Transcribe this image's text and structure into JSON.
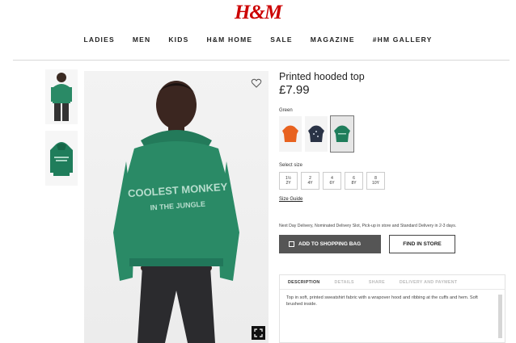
{
  "brand": {
    "logo": "H&M",
    "logo_color": "#cc0000"
  },
  "nav": {
    "items": [
      "LADIES",
      "MEN",
      "KIDS",
      "H&M HOME",
      "SALE",
      "MAGAZINE",
      "#HM GALLERY"
    ]
  },
  "product": {
    "title": "Printed hooded top",
    "price": "£7.99",
    "selected_color": "Green",
    "color_swatches": [
      "orange",
      "navy",
      "green"
    ],
    "print_text_line1": "COOLEST MONKEY",
    "print_text_line2": "IN THE JUNGLE",
    "sizes_label": "Select size",
    "sizes": [
      {
        "top": "1½",
        "bottom": "2Y"
      },
      {
        "top": "2",
        "bottom": "4Y"
      },
      {
        "top": "4",
        "bottom": "6Y"
      },
      {
        "top": "6",
        "bottom": "8Y"
      },
      {
        "top": "8",
        "bottom": "10Y"
      }
    ],
    "size_guide": "Size Guide",
    "delivery_text": "Next Day Delivery, Nominated Delivery Slot, Pick-up in store and Standard Delivery in 2-3 days.",
    "add_to_bag": "ADD TO SHOPPING BAG",
    "find_in_store": "FIND IN STORE",
    "tabs": [
      "DESCRIPTION",
      "DETAILS",
      "SHARE",
      "DELIVERY AND PAYMENT"
    ],
    "description": "Top in soft, printed sweatshirt fabric with a wrapover hood and ribbing at the cuffs and hem. Soft brushed inside."
  },
  "colors": {
    "hoodie_green": "#2a8a66",
    "accent_red": "#cc0000",
    "button_gray": "#555555"
  }
}
